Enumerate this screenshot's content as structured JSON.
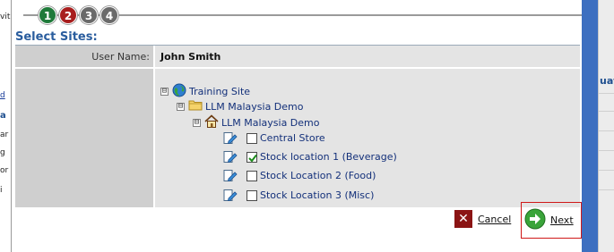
{
  "background_left": {
    "fragments": [
      "vit",
      "d",
      "a",
      "ar",
      "g",
      "or",
      "i"
    ]
  },
  "background_right": {
    "fragment": "uat"
  },
  "wizard": {
    "steps": [
      {
        "number": "1",
        "color": "#1f7a3a"
      },
      {
        "number": "2",
        "color": "#a81e1e"
      },
      {
        "number": "3",
        "color": "#6a6a6a"
      },
      {
        "number": "4",
        "color": "#6a6a6a"
      }
    ],
    "title": "Select Sites:"
  },
  "form": {
    "user_name_label": "User Name:",
    "user_name_value": "John Smith"
  },
  "tree": {
    "root": {
      "toggle": "⊟",
      "label": "Training Site",
      "icon": "globe-icon"
    },
    "region": {
      "toggle": "⊟",
      "label": "LLM Malaysia Demo",
      "icon": "folder-icon"
    },
    "site": {
      "toggle": "⊟",
      "label": "LLM Malaysia Demo",
      "icon": "home-icon"
    },
    "locations": [
      {
        "label": "Central Store",
        "checked": false,
        "icon": "edit-location-icon"
      },
      {
        "label": "Stock location 1 (Beverage)",
        "checked": true,
        "icon": "edit-location-icon"
      },
      {
        "label": "Stock Location 2 (Food)",
        "checked": false,
        "icon": "edit-location-icon"
      },
      {
        "label": "Stock Location 3 (Misc)",
        "checked": false,
        "icon": "edit-location-icon"
      }
    ]
  },
  "actions": {
    "cancel_label": "Cancel",
    "cancel_icon": "close-icon",
    "next_label": "Next",
    "next_icon": "arrow-right-icon"
  },
  "colors": {
    "title": "#2a5d9e",
    "tree_text": "#13307a",
    "cancel_icon": "#8b1414",
    "next_icon": "#3aa43a",
    "highlight": "#d01818"
  }
}
